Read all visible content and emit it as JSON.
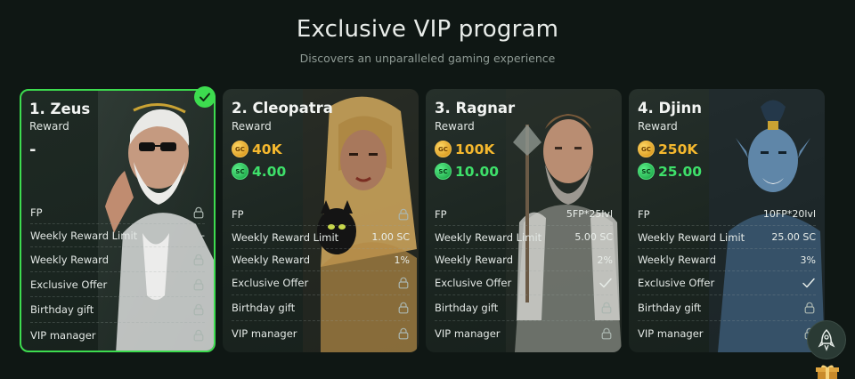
{
  "header": {
    "title": "Exclusive VIP program",
    "subtitle": "Discovers an unparalleled gaming experience"
  },
  "cards": [
    {
      "title": "1. Zeus",
      "reward_label": "Reward",
      "reward_dash": "-",
      "rows": [
        {
          "label": "FP",
          "value": "",
          "icon": "lock-icon"
        },
        {
          "label": "Weekly Reward Limit",
          "value": "-",
          "icon": ""
        },
        {
          "label": "Weekly Reward",
          "value": "",
          "icon": "lock-icon"
        },
        {
          "label": "Exclusive Offer",
          "value": "",
          "icon": "lock-icon"
        },
        {
          "label": "Birthday gift",
          "value": "",
          "icon": "lock-icon"
        },
        {
          "label": "VIP manager",
          "value": "",
          "icon": "lock-icon"
        }
      ]
    },
    {
      "title": "2. Cleopatra",
      "reward_label": "Reward",
      "gc": "40K",
      "sc": "4.00",
      "rows": [
        {
          "label": "FP",
          "value": "",
          "icon": "lock-icon"
        },
        {
          "label": "Weekly Reward Limit",
          "value": "1.00 SC",
          "icon": ""
        },
        {
          "label": "Weekly Reward",
          "value": "1%",
          "icon": ""
        },
        {
          "label": "Exclusive Offer",
          "value": "",
          "icon": "lock-icon"
        },
        {
          "label": "Birthday gift",
          "value": "",
          "icon": "lock-icon"
        },
        {
          "label": "VIP manager",
          "value": "",
          "icon": "lock-icon"
        }
      ]
    },
    {
      "title": "3. Ragnar",
      "reward_label": "Reward",
      "gc": "100K",
      "sc": "10.00",
      "rows": [
        {
          "label": "FP",
          "value": "5FP*25lvl",
          "icon": ""
        },
        {
          "label": "Weekly Reward Limit",
          "value": "5.00 SC",
          "icon": ""
        },
        {
          "label": "Weekly Reward",
          "value": "2%",
          "icon": ""
        },
        {
          "label": "Exclusive Offer",
          "value": "",
          "icon": "checkmark-icon"
        },
        {
          "label": "Birthday gift",
          "value": "",
          "icon": "lock-icon"
        },
        {
          "label": "VIP manager",
          "value": "",
          "icon": "lock-icon"
        }
      ]
    },
    {
      "title": "4. Djinn",
      "reward_label": "Reward",
      "gc": "250K",
      "sc": "25.00",
      "rows": [
        {
          "label": "FP",
          "value": "10FP*20lvl",
          "icon": ""
        },
        {
          "label": "Weekly Reward Limit",
          "value": "25.00 SC",
          "icon": ""
        },
        {
          "label": "Weekly Reward",
          "value": "3%",
          "icon": ""
        },
        {
          "label": "Exclusive Offer",
          "value": "",
          "icon": "checkmark-icon"
        },
        {
          "label": "Birthday gift",
          "value": "",
          "icon": "lock-icon"
        },
        {
          "label": "VIP manager",
          "value": "",
          "icon": "lock-icon"
        }
      ]
    }
  ],
  "coin_labels": {
    "gc": "GC",
    "sc": "SC"
  },
  "colors": {
    "accent_green": "#3ddc4f",
    "gold": "#f5b82e",
    "sweeps_green": "#3ee06a",
    "background": "#0f1714"
  }
}
